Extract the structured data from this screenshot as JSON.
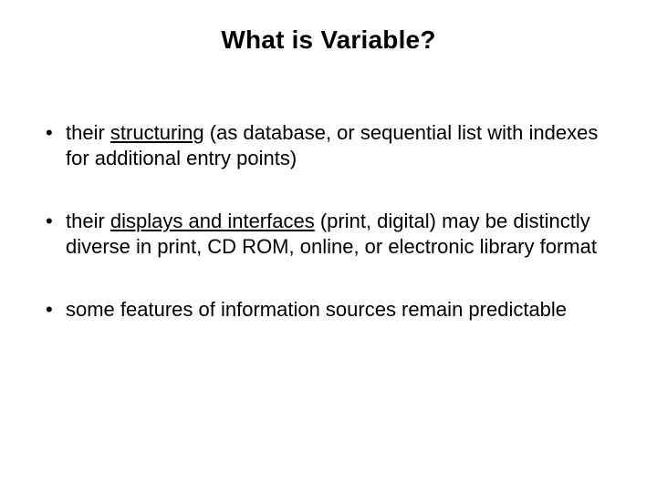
{
  "title": "What is Variable?",
  "bullets": [
    {
      "prefix": "their ",
      "underlined": "structuring",
      "suffix": " (as database, or sequential list with indexes for additional entry points)"
    },
    {
      "prefix": "their ",
      "underlined": "displays and interfaces",
      "suffix": " (print, digital) may be distinctly diverse in print, CD ROM, online, or electronic library format"
    },
    {
      "prefix": "",
      "underlined": "",
      "suffix": "some features of information sources remain predictable"
    }
  ]
}
